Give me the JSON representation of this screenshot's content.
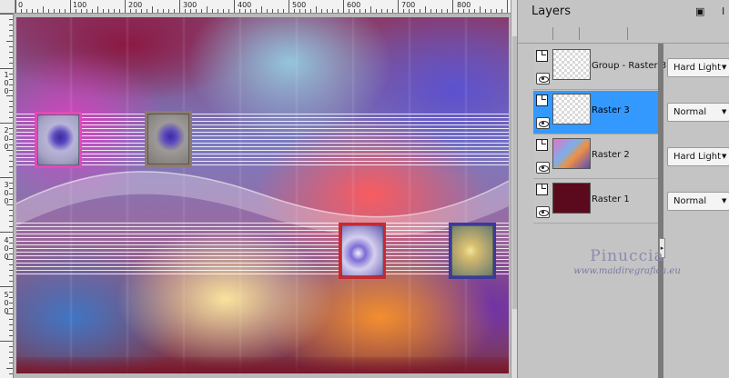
{
  "ruler": {
    "top_labels": [
      "0",
      "100",
      "200",
      "300",
      "400",
      "500",
      "600",
      "700",
      "800"
    ],
    "left_labels": [
      "1",
      "0",
      "0",
      "2",
      "0",
      "0",
      "3",
      "0",
      "0",
      "4",
      "0",
      "0",
      "5",
      "0",
      "0"
    ]
  },
  "layers_panel": {
    "title": "Layers",
    "restore_icon": "▣",
    "extra_icon": "I",
    "layers": [
      {
        "name": "Group - Raster 3",
        "blend_mode": "Hard Light",
        "thumbnail": "checker",
        "selected": false
      },
      {
        "name": "Raster 3",
        "blend_mode": "Normal",
        "thumbnail": "checker",
        "selected": true
      },
      {
        "name": "Raster 2",
        "blend_mode": "Hard Light",
        "thumbnail": "gradient",
        "selected": false
      },
      {
        "name": "Raster 1",
        "blend_mode": "Normal",
        "thumbnail": "solid",
        "selected": false
      }
    ],
    "dropdown_arrow": "▼",
    "divider_grip": "▸"
  },
  "watermark": {
    "name": "Pinuccia",
    "site": "www.maidiregrafica.eu"
  },
  "colors": {
    "selection": "#3399ff",
    "raster1_fill": "#5a0a1c",
    "panel_bg": "#c4c4c4"
  }
}
